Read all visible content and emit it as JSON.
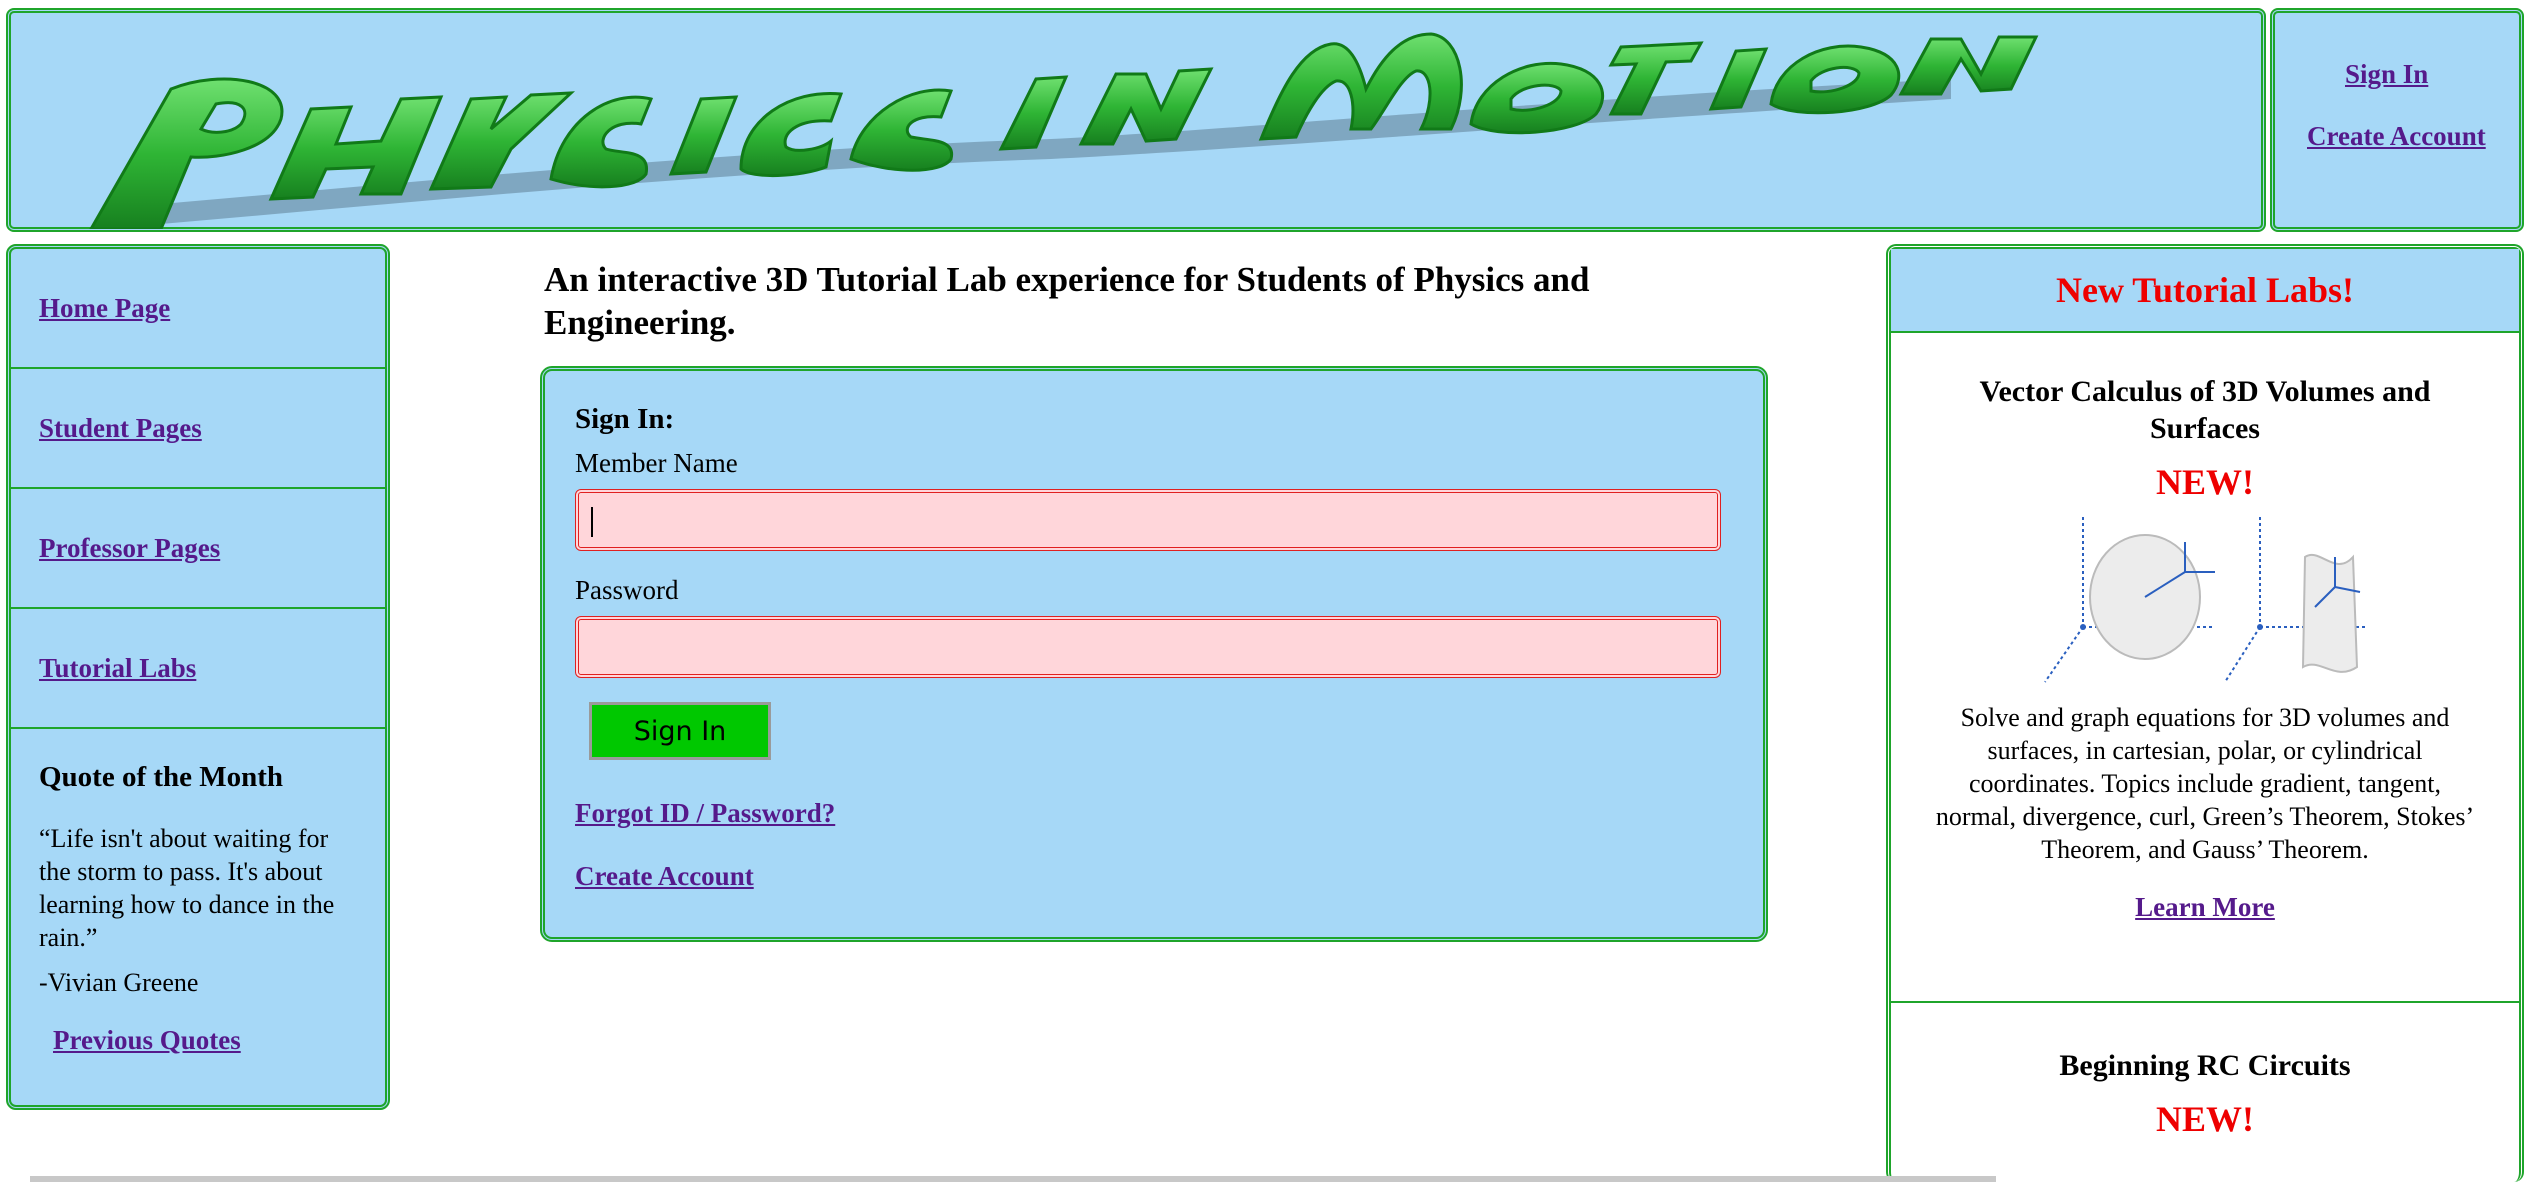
{
  "header": {
    "logo_text": "Physics in Motion",
    "signin_label": "Sign In",
    "create_account_label": "Create Account"
  },
  "nav": {
    "items": [
      {
        "label": "Home Page"
      },
      {
        "label": "Student Pages"
      },
      {
        "label": "Professor Pages"
      },
      {
        "label": "Tutorial Labs"
      }
    ]
  },
  "quote": {
    "heading": "Quote of the Month",
    "text": "“Life isn't about waiting for the storm to pass. It's about learning how to dance in the rain.”",
    "author": "-Vivian Greene",
    "previous_label": "Previous Quotes"
  },
  "main": {
    "tagline": "An interactive 3D Tutorial Lab experience for Students of Physics and Engineering.",
    "signin": {
      "title": "Sign In:",
      "member_label": "Member Name",
      "member_value": "",
      "password_label": "Password",
      "password_value": "",
      "button_label": "Sign In",
      "forgot_label": "Forgot ID / Password?",
      "create_label": "Create Account"
    }
  },
  "right": {
    "header": "New Tutorial Labs!",
    "labs": [
      {
        "title": "Vector Calculus of 3D Volumes and Surfaces",
        "badge": "NEW!",
        "description": "Solve and graph equations for 3D volumes and surfaces, in cartesian, polar, or cylindrical coordinates. Topics include gradient, tangent, normal, divergence, curl, Green’s Theorem, Stokes’ Theorem, and Gauss’ Theorem.",
        "link": "Learn More"
      },
      {
        "title": "Beginning RC Circuits",
        "badge": "NEW!"
      }
    ]
  },
  "colors": {
    "panel_blue": "#a6d8f7",
    "border_green": "#1fa52b",
    "alert_red": "#ee0000",
    "field_pink": "#ffd6da",
    "button_green": "#00c800",
    "link_purple": "#551a8b"
  }
}
